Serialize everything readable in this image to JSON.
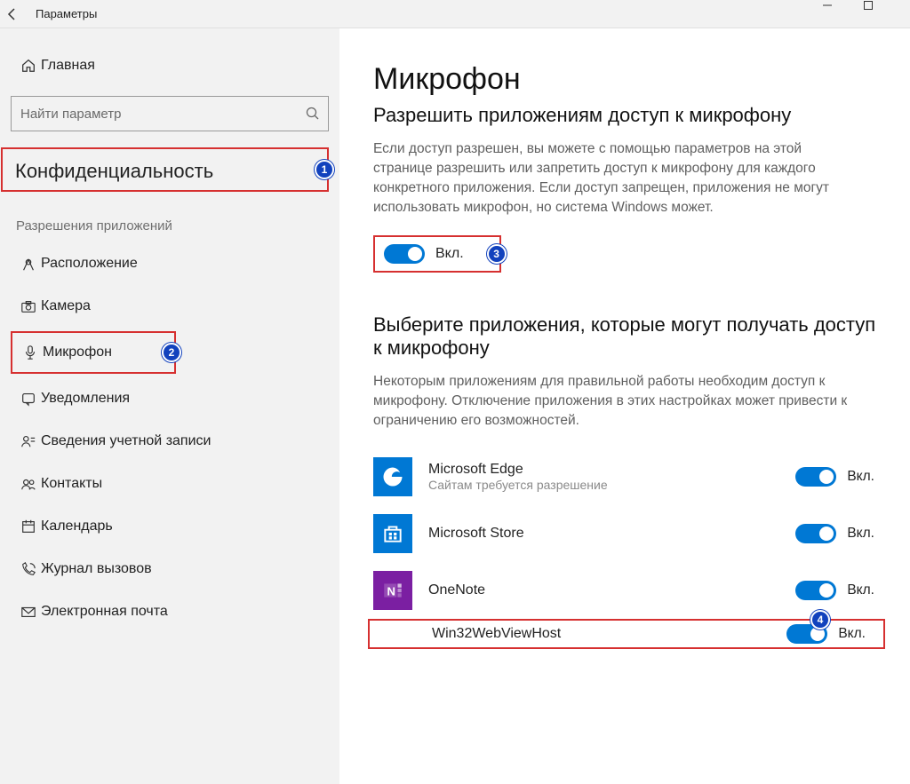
{
  "titlebar": {
    "title": "Параметры"
  },
  "sidebar": {
    "home": "Главная",
    "search_placeholder": "Найти параметр",
    "category": "Конфиденциальность",
    "group_title": "Разрешения приложений",
    "items": [
      {
        "label": "Расположение"
      },
      {
        "label": "Камера"
      },
      {
        "label": "Микрофон"
      },
      {
        "label": "Уведомления"
      },
      {
        "label": "Сведения учетной записи"
      },
      {
        "label": "Контакты"
      },
      {
        "label": "Календарь"
      },
      {
        "label": "Журнал вызовов"
      },
      {
        "label": "Электронная почта"
      }
    ]
  },
  "main": {
    "page_title": "Микрофон",
    "allow_heading": "Разрешить приложениям доступ к микрофону",
    "allow_desc": "Если доступ разрешен, вы можете с помощью параметров на этой странице разрешить или запретить доступ к микрофону для каждого конкретного приложения. Если доступ запрещен, приложения не могут использовать микрофон, но система Windows может.",
    "on_label": "Вкл.",
    "choose_heading": "Выберите приложения, которые могут получать доступ к микрофону",
    "choose_desc": "Некоторым приложениям для правильной работы необходим доступ к микрофону. Отключение приложения в этих настройках может привести к ограничению его возможностей.",
    "apps": [
      {
        "name": "Microsoft Edge",
        "sub": "Сайтам требуется разрешение",
        "state": "Вкл."
      },
      {
        "name": "Microsoft Store",
        "sub": "",
        "state": "Вкл."
      },
      {
        "name": "OneNote",
        "sub": "",
        "state": "Вкл."
      },
      {
        "name": "Win32WebViewHost",
        "sub": "",
        "state": "Вкл."
      }
    ]
  },
  "badges": {
    "b1": "1",
    "b2": "2",
    "b3": "3",
    "b4": "4"
  }
}
